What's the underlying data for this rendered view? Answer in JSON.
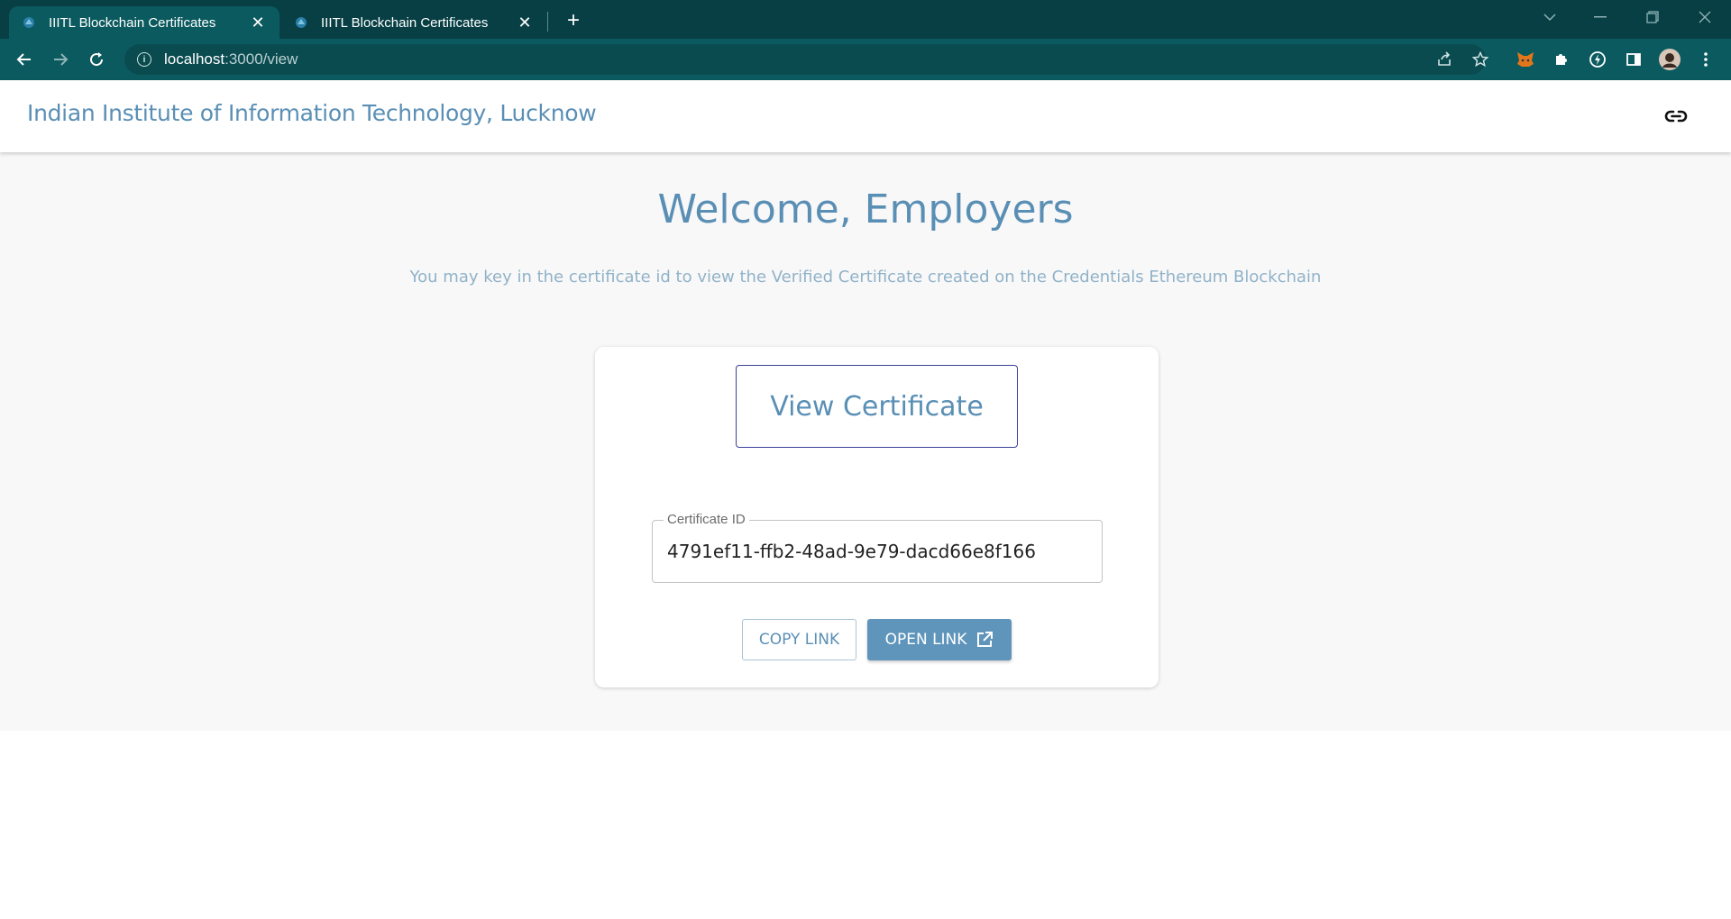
{
  "browser": {
    "tabs": [
      {
        "title": "IIITL Blockchain Certificates",
        "active": true
      },
      {
        "title": "IIITL Blockchain Certificates",
        "active": false
      }
    ],
    "url_host": "localhost",
    "url_path": ":3000/view",
    "accent": "#073f45"
  },
  "header": {
    "brand": "Indian Institute of Information Technology, Lucknow"
  },
  "main": {
    "welcome": "Welcome, Employers",
    "subtitle": "You may key in the certificate id to view the Verified Certificate created on the Credentials Ethereum Blockchain"
  },
  "card": {
    "view_button": "View Certificate",
    "field_label": "Certificate ID",
    "field_value": "4791ef11-ffb2-48ad-9e79-dacd66e8f166",
    "copy_link": "COPY LINK",
    "open_link": "OPEN LINK"
  },
  "colors": {
    "brand": "#5a8fb5",
    "primary_button": "#5f95bb"
  }
}
